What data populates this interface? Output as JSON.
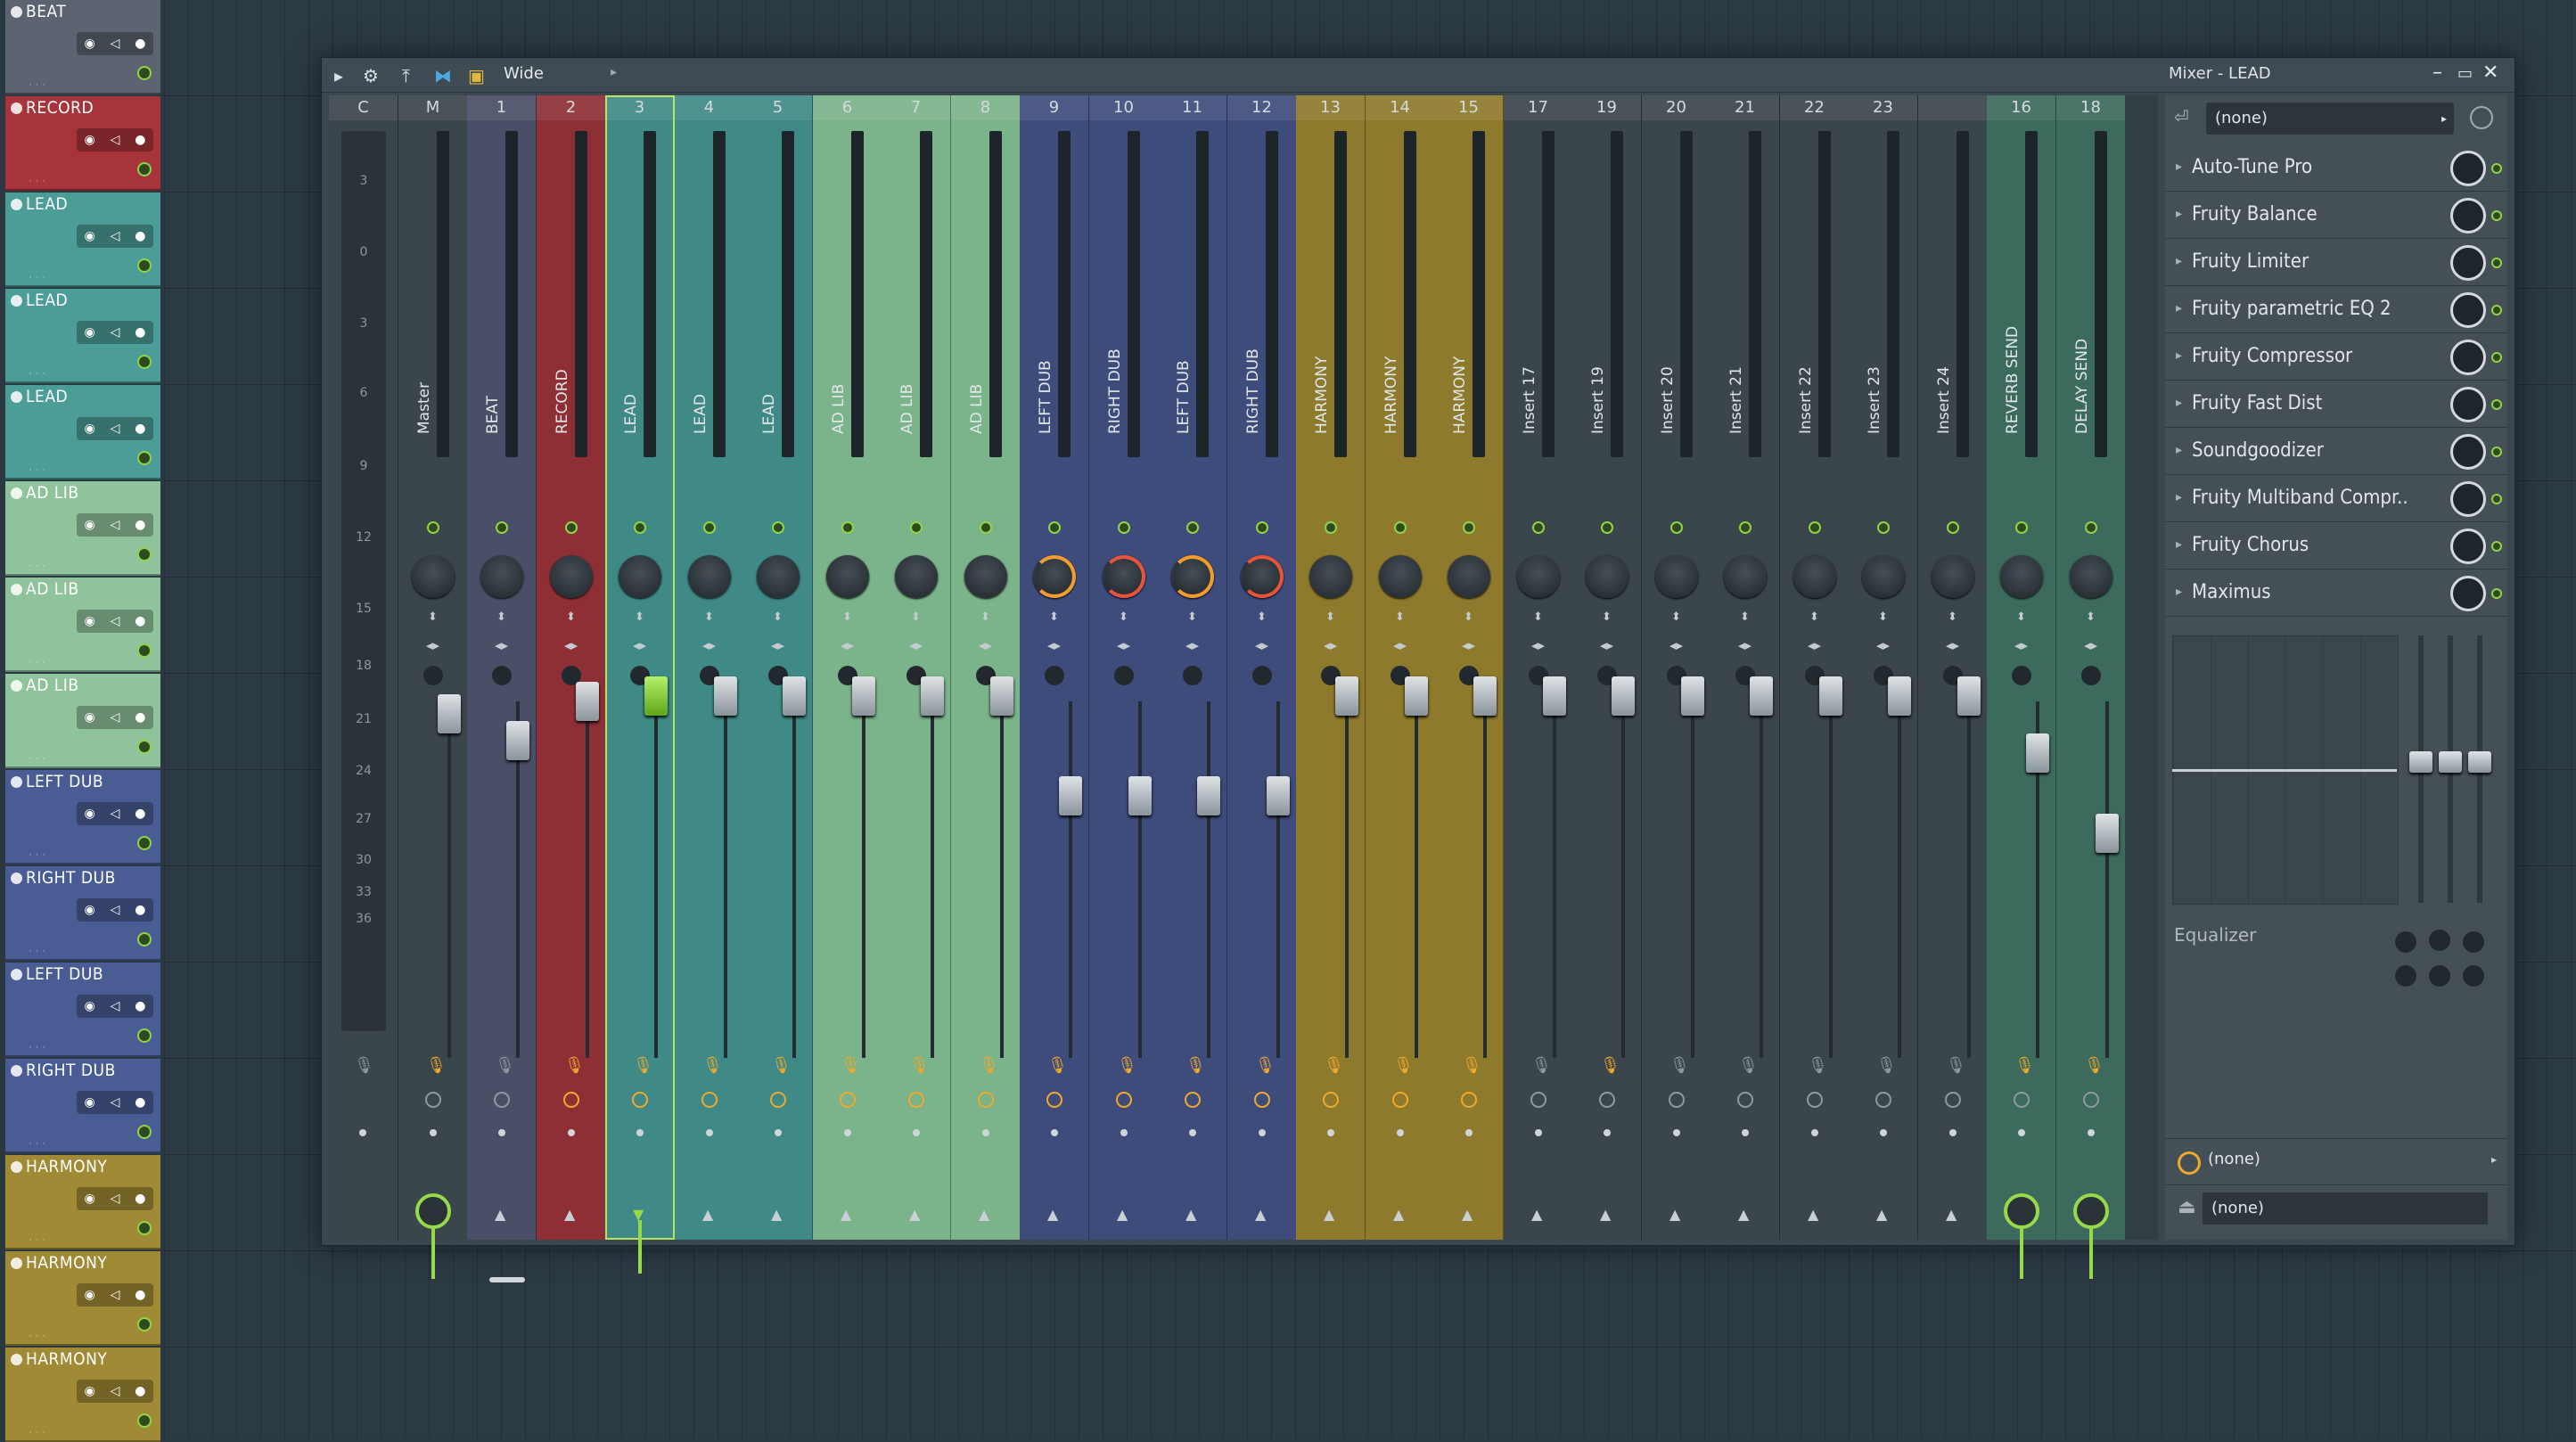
{
  "tracks": [
    {
      "name": "BEAT",
      "color": "#5b6470"
    },
    {
      "name": "RECORD",
      "color": "#a8343b"
    },
    {
      "name": "LEAD",
      "color": "#4c9d98"
    },
    {
      "name": "LEAD",
      "color": "#4c9d98"
    },
    {
      "name": "LEAD",
      "color": "#4c9d98"
    },
    {
      "name": "AD LIB",
      "color": "#8fc39c"
    },
    {
      "name": "AD LIB",
      "color": "#8fc39c"
    },
    {
      "name": "AD LIB",
      "color": "#8fc39c"
    },
    {
      "name": "LEFT DUB",
      "color": "#4a5c94"
    },
    {
      "name": "RIGHT DUB",
      "color": "#4a5c94"
    },
    {
      "name": "LEFT DUB",
      "color": "#4a5c94"
    },
    {
      "name": "RIGHT DUB",
      "color": "#4a5c94"
    },
    {
      "name": "HARMONY",
      "color": "#a18a35"
    },
    {
      "name": "HARMONY",
      "color": "#a18a35"
    },
    {
      "name": "HARMONY",
      "color": "#a18a35"
    }
  ],
  "toolbar": {
    "preset": "Wide"
  },
  "mixer": {
    "title": "Mixer - LEAD"
  },
  "scale": [
    "3",
    "0",
    "3",
    "6",
    "9",
    "12",
    "15",
    "18",
    "21",
    "24",
    "27",
    "30",
    "33",
    "36"
  ],
  "strips": [
    {
      "num": "C",
      "name": "",
      "color": "#3b454c"
    },
    {
      "num": "M",
      "name": "Master",
      "color": "#3b454c"
    },
    {
      "num": "1",
      "name": "BEAT",
      "color": "#4a4f68"
    },
    {
      "num": "2",
      "name": "RECORD",
      "color": "#8e2f36"
    },
    {
      "num": "3",
      "name": "LEAD",
      "color": "#3f8a86"
    },
    {
      "num": "4",
      "name": "LEAD",
      "color": "#3f8a86"
    },
    {
      "num": "5",
      "name": "LEAD",
      "color": "#3f8a86"
    },
    {
      "num": "6",
      "name": "AD LIB",
      "color": "#7bb38a"
    },
    {
      "num": "7",
      "name": "AD LIB",
      "color": "#7bb38a"
    },
    {
      "num": "8",
      "name": "AD LIB",
      "color": "#7bb38a"
    },
    {
      "num": "9",
      "name": "LEFT DUB",
      "color": "#3e4c7c"
    },
    {
      "num": "10",
      "name": "RIGHT DUB",
      "color": "#3e4c7c"
    },
    {
      "num": "11",
      "name": "LEFT DUB",
      "color": "#3e4c7c"
    },
    {
      "num": "12",
      "name": "RIGHT DUB",
      "color": "#3e4c7c"
    },
    {
      "num": "13",
      "name": "HARMONY",
      "color": "#8e7a2c"
    },
    {
      "num": "14",
      "name": "HARMONY",
      "color": "#8e7a2c"
    },
    {
      "num": "15",
      "name": "HARMONY",
      "color": "#8e7a2c"
    },
    {
      "num": "17",
      "name": "Insert 17",
      "color": "#3b454c"
    },
    {
      "num": "19",
      "name": "Insert 19",
      "color": "#3b454c"
    },
    {
      "num": "20",
      "name": "Insert 20",
      "color": "#3b454c"
    },
    {
      "num": "21",
      "name": "Insert 21",
      "color": "#3b454c"
    },
    {
      "num": "22",
      "name": "Insert 22",
      "color": "#3b454c"
    },
    {
      "num": "23",
      "name": "Insert 23",
      "color": "#3b454c"
    },
    {
      "num": "",
      "name": "Insert 24",
      "color": "#3b454c"
    },
    {
      "num": "16",
      "name": "REVERB SEND",
      "color": "#3c6a5c"
    },
    {
      "num": "18",
      "name": "DELAY SEND",
      "color": "#3c6a5c"
    }
  ],
  "fx": {
    "input": "(none)",
    "slots": [
      "Auto-Tune Pro",
      "Fruity Balance",
      "Fruity Limiter",
      "Fruity parametric EQ 2",
      "Fruity Compressor",
      "Fruity Fast Dist",
      "Soundgoodizer",
      "Fruity Multiband Compr..",
      "Fruity Chorus",
      "Maximus"
    ],
    "eq_label": "Equalizer",
    "out1": "(none)",
    "out2": "(none)"
  },
  "colors": {
    "accent": "#96d94a",
    "orange": "#f19c2c",
    "red": "#e9533a"
  }
}
